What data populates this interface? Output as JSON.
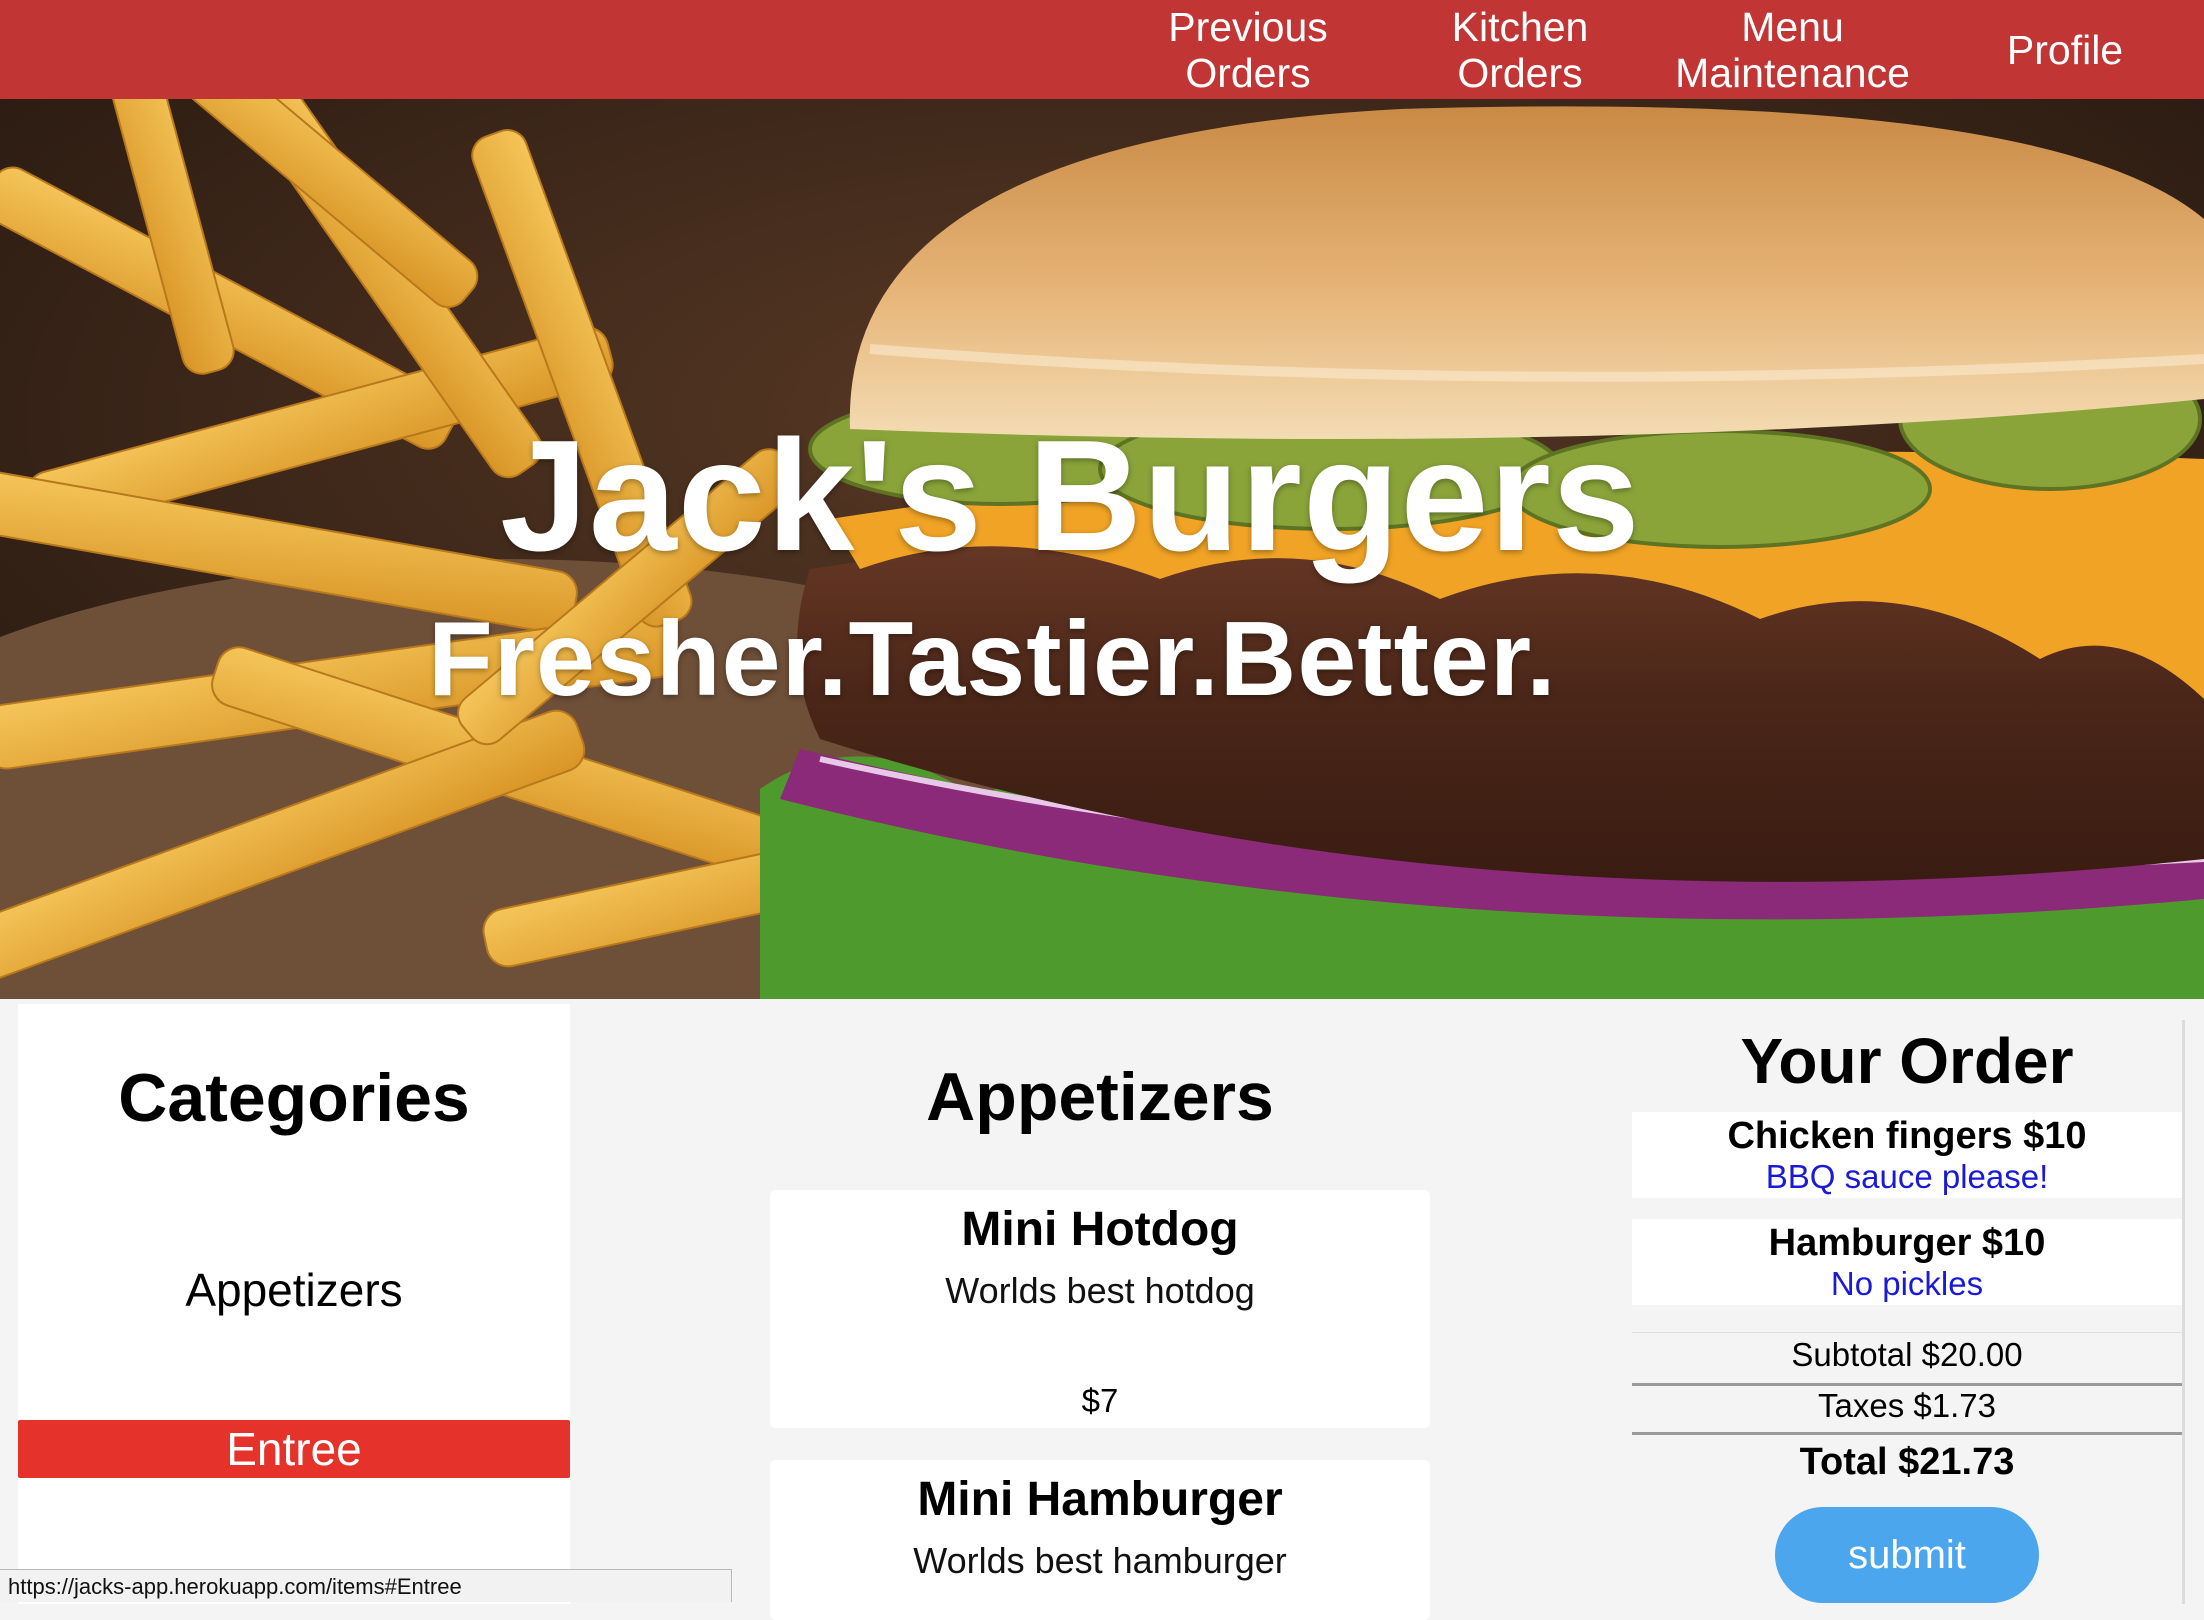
{
  "nav": {
    "previous_orders": [
      "Previous",
      "Orders"
    ],
    "kitchen_orders": [
      "Kitchen",
      "Orders"
    ],
    "menu_maintenance": [
      "Menu",
      "Maintenance"
    ],
    "profile": "Profile"
  },
  "hero": {
    "title": "Jack's Burgers",
    "tagline": "Fresher.Tastier.Better."
  },
  "categories": {
    "heading": "Categories",
    "items": [
      "Appetizers",
      "Entree"
    ],
    "selected": "Entree"
  },
  "menu": {
    "heading": "Appetizers",
    "items": [
      {
        "name": "Mini Hotdog",
        "description": "Worlds best hotdog",
        "price": "$7"
      },
      {
        "name": "Mini Hamburger",
        "description": "Worlds best hamburger"
      }
    ]
  },
  "order": {
    "heading": "Your Order",
    "lines": [
      {
        "name": "Chicken fingers $10",
        "note": "BBQ sauce please!"
      },
      {
        "name": "Hamburger $10",
        "note": "No pickles"
      }
    ],
    "subtotal": "Subtotal $20.00",
    "taxes": "Taxes $1.73",
    "total": "Total $21.73",
    "submit_label": "submit"
  },
  "status_bar": {
    "url": "https://jacks-app.herokuapp.com/items#Entree"
  },
  "colors": {
    "nav_bg": "#c13535",
    "selected_category": "#e5322a",
    "note_text": "#1a1ad6",
    "submit_bg": "#4ba6ee"
  }
}
